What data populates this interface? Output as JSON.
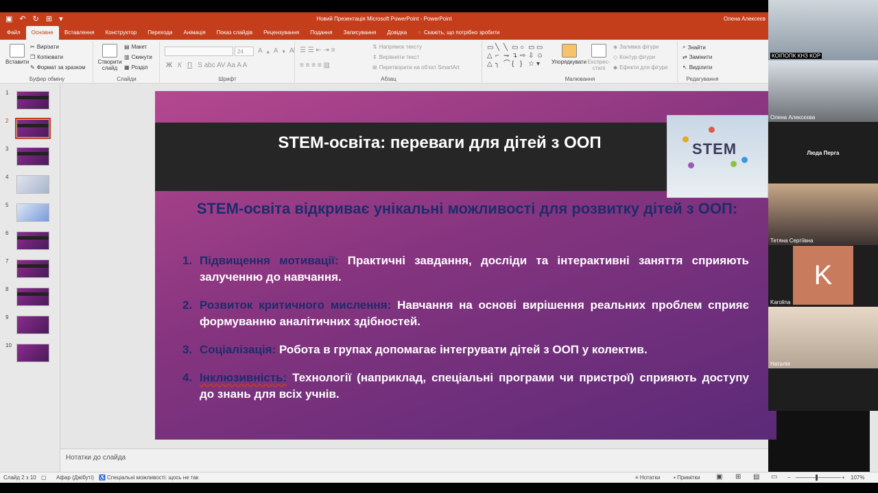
{
  "window": {
    "title": "Новий Презентація Microsoft PowerPoint - PowerPoint",
    "user": "Олена Алексеєв"
  },
  "tabs": [
    {
      "label": "Файл"
    },
    {
      "label": "Основне",
      "active": true
    },
    {
      "label": "Вставлення"
    },
    {
      "label": "Конструктор"
    },
    {
      "label": "Переходи"
    },
    {
      "label": "Анімація"
    },
    {
      "label": "Показ слайдів"
    },
    {
      "label": "Рецензування"
    },
    {
      "label": "Подання"
    },
    {
      "label": "Записування"
    },
    {
      "label": "Довідка"
    }
  ],
  "tell_me": "Скажіть, що потрібно зробити",
  "ribbon": {
    "clipboard": {
      "paste": "Вставити",
      "cut": "Вирізати",
      "copy": "Копіювати",
      "format": "Формат за зразком",
      "label": "Буфер обміну"
    },
    "slides": {
      "new": "Створити слайд",
      "layout": "Макет",
      "reset": "Скинути",
      "section": "Розділ",
      "label": "Слайди"
    },
    "font": {
      "size": "24",
      "label": "Шрифт"
    },
    "paragraph": {
      "direction": "Напрямок тексту",
      "align": "Вирівняти текст",
      "smartart": "Перетворити на об'єкт SmartArt",
      "label": "Абзац"
    },
    "drawing": {
      "arrange": "Упорядкувати",
      "styles": "Експрес-стилі",
      "fill": "Заливка фігури",
      "outline": "Контур фігури",
      "effects": "Ефекти для фігури",
      "label": "Малювання"
    },
    "editing": {
      "find": "Знайти",
      "replace": "Замінити",
      "select": "Виділити",
      "label": "Редагування"
    }
  },
  "slides_panel": [
    {
      "num": "1"
    },
    {
      "num": "2",
      "active": true
    },
    {
      "num": "3"
    },
    {
      "num": "4"
    },
    {
      "num": "5"
    },
    {
      "num": "6"
    },
    {
      "num": "7"
    },
    {
      "num": "8"
    },
    {
      "num": "9"
    },
    {
      "num": "10"
    }
  ],
  "slide": {
    "title": "STEM-освіта: переваги для дітей з ООП",
    "picture_text": "STEM",
    "subtitle": "STEM-освіта відкриває унікальні можливості для розвитку дітей з ООП:",
    "items": [
      {
        "num": "1.",
        "heading": "Підвищення мотивації:",
        "text": "Практичні завдання, досліди та інтерактивні заняття сприяють залученню до навчання."
      },
      {
        "num": "2.",
        "heading": "Розвиток критичного мислення:",
        "text": "Навчання на основі вирішення реальних проблем сприяє формуванню аналітичних здібностей."
      },
      {
        "num": "3.",
        "heading": "Соціалізація:",
        "text": "Робота в групах допомагає інтегрувати дітей з ООП у колектив."
      },
      {
        "num": "4.",
        "heading": "Інклюзивність:",
        "text": "Технології (наприклад, спеціальні програми чи пристрої) сприяють доступу до знань для всіх учнів."
      }
    ]
  },
  "notes_placeholder": "Нотатки до слайда",
  "status": {
    "slide": "Слайд 2 з 10",
    "language": "Афар (Джібуті)",
    "accessibility": "Спеціальні можливості: щось не так",
    "notes": "Нотатки",
    "comments": "Примітки",
    "zoom": "107%"
  },
  "participants": [
    {
      "name": "КОІПОПК КНЗ КОР"
    },
    {
      "name": "Олена Алексєєва"
    },
    {
      "name": "Люда Перга"
    },
    {
      "name": "Тетяна Сергіївна"
    },
    {
      "name": "Karolina",
      "initial": "K"
    },
    {
      "name": "Наталія"
    }
  ]
}
